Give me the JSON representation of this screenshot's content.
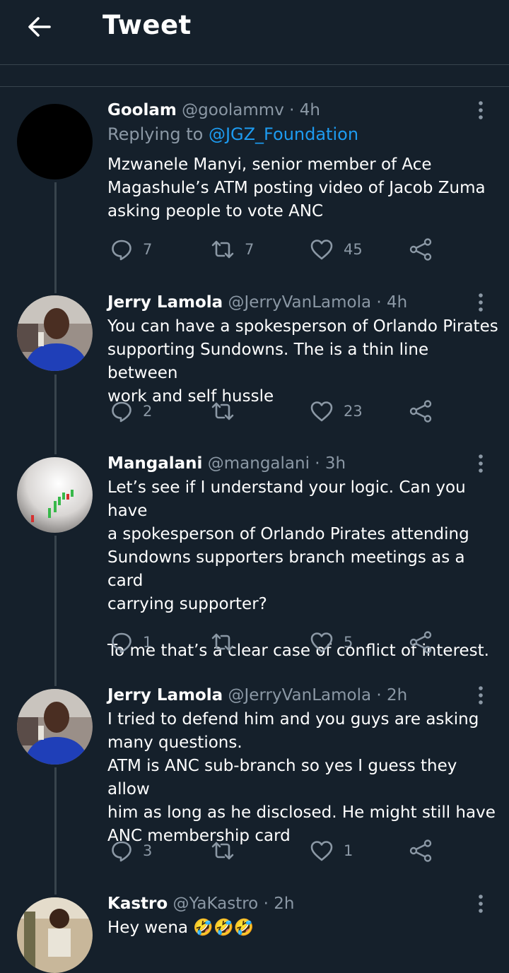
{
  "header": {
    "title": "Tweet"
  },
  "tweets": [
    {
      "name": "Goolam",
      "handle": "@goolammv",
      "time": "4h",
      "replying_prefix": "Replying to ",
      "replying_to": "@JGZ_Foundation",
      "text": "Mzwanele Manyi, senior member of Ace\nMagashule’s ATM posting video of Jacob Zuma\nasking people to vote ANC",
      "replies": "7",
      "retweets": "7",
      "likes": "45"
    },
    {
      "name": "Jerry Lamola",
      "handle": "@JerryVanLamola",
      "time": "4h",
      "text": "You can have a spokesperson of Orlando Pirates\nsupporting Sundowns. The is a thin line between\nwork and self hussle",
      "replies": "2",
      "retweets": "",
      "likes": "23"
    },
    {
      "name": "Mangalani",
      "handle": "@mangalani",
      "time": "3h",
      "text": "Let’s see if I understand your logic. Can you have\na spokesperson of Orlando Pirates attending\nSundowns supporters branch meetings as a card\ncarrying supporter?\n\nTo me that’s a clear case of conflict of interest.",
      "replies": "1",
      "retweets": "",
      "likes": "5"
    },
    {
      "name": "Jerry Lamola",
      "handle": "@JerryVanLamola",
      "time": "2h",
      "text": "I tried to defend him and you guys are asking\nmany questions.\nATM is ANC sub-branch so yes I guess they allow\nhim as long as he disclosed. He might still have\nANC membership card",
      "replies": "3",
      "retweets": "",
      "likes": "1"
    },
    {
      "name": "Kastro",
      "handle": "@YaKastro",
      "time": "2h",
      "text": "Hey wena 🤣🤣🤣"
    }
  ],
  "icons": {
    "back": "arrow-left-icon",
    "more": "more-vertical-icon",
    "reply": "reply-icon",
    "retweet": "retweet-icon",
    "like": "heart-icon",
    "share": "share-icon"
  },
  "colors": {
    "background": "#15202b",
    "accent": "#1d9bf0",
    "secondary_text": "#8b98a5",
    "divider": "#38444d"
  }
}
